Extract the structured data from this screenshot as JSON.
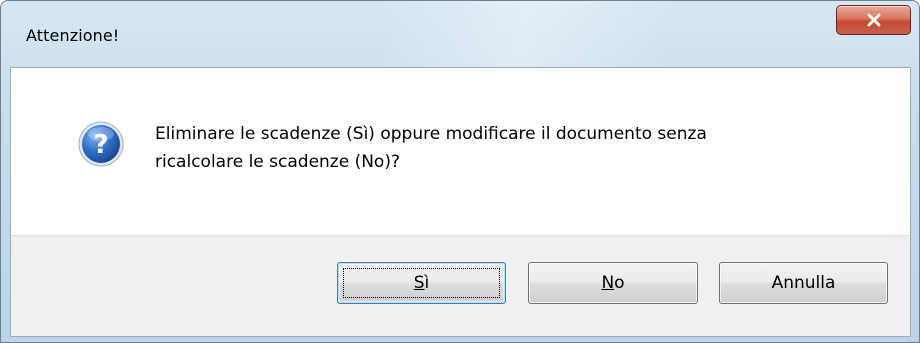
{
  "window": {
    "title": "Attenzione!",
    "close_icon": "close-icon"
  },
  "message": {
    "icon": "question-icon",
    "line1": "Eliminare le scadenze (Sì) oppure modificare il documento senza",
    "line2": "ricalcolare le scadenze (No)?"
  },
  "buttons": {
    "yes": {
      "mnemonic": "S",
      "rest": "ì"
    },
    "no": {
      "mnemonic": "N",
      "rest": "o"
    },
    "cancel": {
      "label": "Annulla"
    }
  },
  "colors": {
    "close_button": "#c9604a",
    "question_icon": "#2a64b8",
    "default_button_border": "#3c7fb1",
    "button_bar": "#f0f0f0"
  }
}
